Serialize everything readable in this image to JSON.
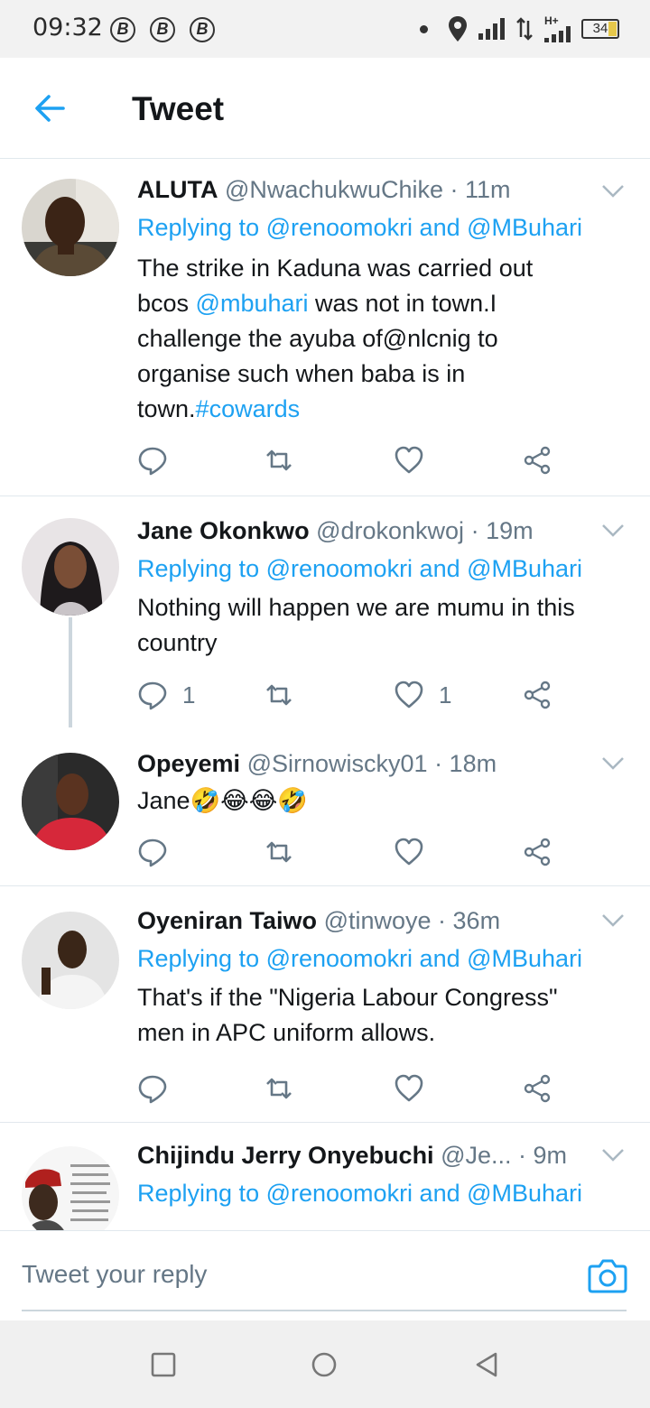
{
  "status_bar": {
    "time": "09:32",
    "b_icons": [
      "B",
      "B",
      "B"
    ],
    "net_label": "H+",
    "battery": "34"
  },
  "header": {
    "title": "Tweet"
  },
  "tweets": [
    {
      "name": "ALUTA",
      "handle": "@NwachukwuChike",
      "time": "· 11m",
      "replying_prefix": "Replying to ",
      "replying_to": "@renoomokri and @MBuhari",
      "body_lines": [
        [
          {
            "t": "The strike in Kaduna was carried out"
          }
        ],
        [
          {
            "t": "bcos "
          },
          {
            "t": "@mbuhari",
            "link": true
          },
          {
            "t": " was not in town.I"
          }
        ],
        [
          {
            "t": "challenge the ayuba of@nlcnig to"
          }
        ],
        [
          {
            "t": "organise such when baba is in"
          }
        ],
        [
          {
            "t": "town."
          },
          {
            "t": "#cowards",
            "link": true
          }
        ]
      ],
      "reply_count": "",
      "like_count": ""
    },
    {
      "name": "Jane Okonkwo",
      "handle": "@drokonkwoj",
      "time": "· 19m",
      "replying_prefix": "Replying to ",
      "replying_to": "@renoomokri and @MBuhari",
      "body_lines": [
        [
          {
            "t": "Nothing will happen we are mumu in this"
          }
        ],
        [
          {
            "t": "country"
          }
        ]
      ],
      "reply_count": "1",
      "like_count": "1"
    },
    {
      "name": "Opeyemi",
      "handle": "@Sirnowiscky01",
      "time": "· 18m",
      "body_lines": [
        [
          {
            "t": "Jane🤣😂😂🤣"
          }
        ]
      ],
      "reply_count": "",
      "like_count": ""
    },
    {
      "name": "Oyeniran Taiwo",
      "handle": "@tinwoye",
      "time": "· 36m",
      "replying_prefix": "Replying to ",
      "replying_to": "@renoomokri and @MBuhari",
      "body_lines": [
        [
          {
            "t": "That's if the \"Nigeria Labour Congress\""
          }
        ],
        [
          {
            "t": "men in APC uniform allows."
          }
        ]
      ],
      "reply_count": "",
      "like_count": ""
    },
    {
      "name": "Chijindu Jerry Onyebuchi",
      "handle": "@Je...",
      "time": "· 9m",
      "replying_prefix": "Replying to ",
      "replying_to": "@renoomokri and @MBuhari"
    }
  ],
  "reply_bar": {
    "placeholder": "Tweet your reply"
  },
  "colors": {
    "accent": "#1da1f2",
    "text": "#14171a",
    "muted": "#657786",
    "divider": "#e1e8ed"
  },
  "icons": [
    "back-arrow-icon",
    "chevron-down-icon",
    "reply-icon",
    "retweet-icon",
    "like-icon",
    "share-icon",
    "camera-icon",
    "recents-square-icon",
    "home-circle-icon",
    "back-triangle-icon"
  ]
}
